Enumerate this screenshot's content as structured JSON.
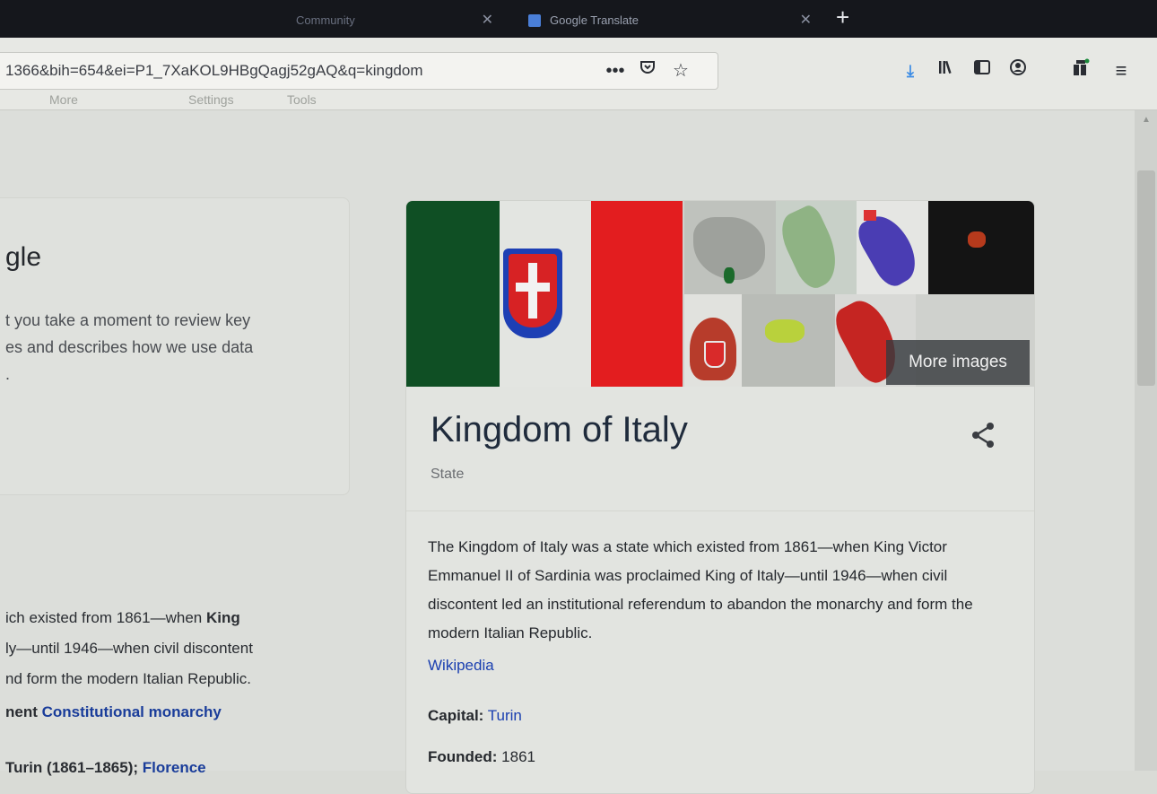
{
  "browser": {
    "tabs": [
      {
        "label": "Community"
      },
      {
        "label": "Google Translate"
      }
    ],
    "new_tab_symbol": "+",
    "close_symbol": "✕",
    "url": "1366&bih=654&ei=P1_7XaKOL9HBgQagj52gAQ&q=kingdom"
  },
  "google_nav": {
    "items": [
      "More",
      "Settings",
      "Tools"
    ]
  },
  "consent": {
    "title": "gle",
    "body_lines": [
      "t you take a moment to review key",
      "es and describes how we use data",
      "."
    ]
  },
  "left_summary": {
    "line1_a": "ich existed from 1861—when ",
    "line1_b": "King",
    "line2": "ly—until 1946—when civil discontent",
    "line3": "nd form the modern Italian Republic.",
    "gov_label": "nent",
    "gov_value": "Constitutional monarchy",
    "capitals_label": "Turin",
    "capitals_years": "(1861–1865);",
    "capitals_next": "Florence"
  },
  "knowledge_panel": {
    "more_images": "More images",
    "title": "Kingdom of Italy",
    "subtitle": "State",
    "description": "The Kingdom of Italy was a state which existed from 1861—when King Victor Emmanuel II of Sardinia was proclaimed King of Italy—until 1946—when civil discontent led an institutional referendum to abandon the monarchy and form the modern Italian Republic.",
    "source": "Wikipedia",
    "facts": {
      "capital_label": "Capital:",
      "capital_value": "Turin",
      "founded_label": "Founded:",
      "founded_value": "1861"
    }
  },
  "colors": {
    "flag_green": "#0f4f24",
    "flag_red": "#e31d1f",
    "link_blue": "#1a3fb0",
    "download_blue": "#3c8ce4"
  },
  "icons": [
    "close-icon",
    "new-tab-icon",
    "translate-favicon",
    "more-actions-icon",
    "pocket-icon",
    "bookmark-star-icon",
    "download-icon",
    "library-icon",
    "sidebar-icon",
    "account-icon",
    "extension-icon",
    "menu-icon",
    "share-icon"
  ]
}
